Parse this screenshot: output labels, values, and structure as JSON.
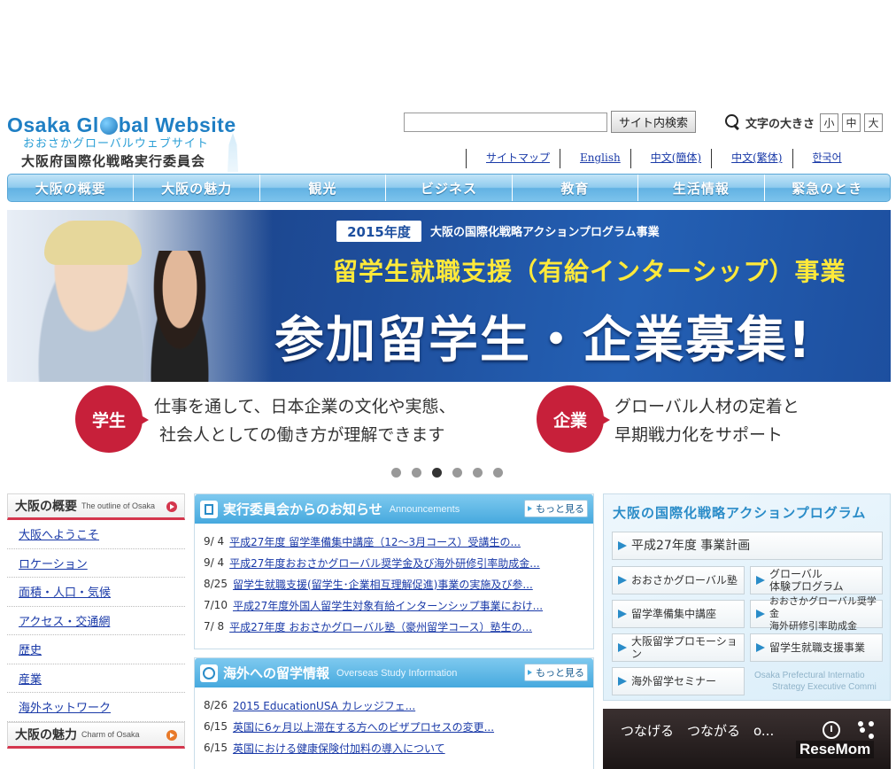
{
  "logo": {
    "en_pre": "Osaka Gl",
    "en_post": "bal Website",
    "jp_sub": "おおさかグローバルウェブサイト",
    "jp_org": "大阪府国際化戦略実行委員会"
  },
  "search": {
    "value": "",
    "button_label": "サイト内検索"
  },
  "font_size": {
    "label": "文字の大きさ",
    "small": "小",
    "medium": "中",
    "large": "大"
  },
  "lang_links": [
    "サイトマップ",
    "English",
    "中文(簡体)",
    "中文(繁体)",
    "한국어"
  ],
  "global_nav": [
    "大阪の概要",
    "大阪の魅力",
    "観光",
    "ビジネス",
    "教育",
    "生活情報",
    "緊急のとき"
  ],
  "hero": {
    "year": "2015年度",
    "subtitle": "大阪の国際化戦略アクションプログラム事業",
    "title1": "留学生就職支援（有給インターシップ）事業",
    "title2": "参加留学生・企業募集!",
    "badge_student": "学生",
    "student_line1": "仕事を通して、日本企業の文化や実態、",
    "student_line2": "社会人としての働き方が理解できます",
    "badge_company": "企業",
    "company_line1": "グローバル人材の定着と",
    "company_line2": "早期戦力化をサポート",
    "slide_count": 6,
    "active_slide": 3
  },
  "sidebar": {
    "section1": {
      "title": "大阪の概要",
      "title_en": "The outline of Osaka",
      "items": [
        "大阪へようこそ",
        "ロケーション",
        "面積・人口・気候",
        "アクセス・交通網",
        "歴史",
        "産業",
        "海外ネットワーク"
      ]
    },
    "section2": {
      "title": "大阪の魅力",
      "title_en": "Charm of Osaka"
    }
  },
  "announcements": {
    "title": "実行委員会からのお知らせ",
    "title_en": "Announcements",
    "more": "もっと見る",
    "items": [
      {
        "date": "9/ 4",
        "text": "平成27年度 留学準備集中講座（12～3月コース）受講生の..."
      },
      {
        "date": "9/ 4",
        "text": "平成27年度おおさかグローバル奨学金及び海外研修引率助成金..."
      },
      {
        "date": "8/25",
        "text": "留学生就職支援(留学生･企業相互理解促進)事業の実施及び参..."
      },
      {
        "date": "7/10",
        "text": "平成27年度外国人留学生対象有給インターンシップ事業におけ..."
      },
      {
        "date": "7/ 8",
        "text": "平成27年度 おおさかグローバル塾（豪州留学コース）塾生の..."
      }
    ]
  },
  "overseas": {
    "title": "海外への留学情報",
    "title_en": "Overseas Study Information",
    "more": "もっと見る",
    "items": [
      {
        "date": "8/26",
        "text": "2015 EducationUSA カレッジフェ..."
      },
      {
        "date": "6/15",
        "text": "英国に6ヶ月以上滞在する方へのビザプロセスの変更..."
      },
      {
        "date": "6/15",
        "text": "英国における健康保険付加料の導入について"
      }
    ]
  },
  "action_program": {
    "title": "大阪の国際化戦略アクションプログラム",
    "plan": "平成27年度 事業計画",
    "btn1": "おおさかグローバル塾",
    "btn2_l1": "グローバル",
    "btn2_l2": "体験プログラム",
    "btn3": "留学準備集中講座",
    "btn4_l1": "おおさかグローバル奨学金",
    "btn4_l2": "海外研修引率助成金",
    "btn5": "大阪留学プロモーション",
    "btn6": "留学生就職支援事業",
    "btn7": "海外留学セミナー",
    "watermark_l1": "Osaka Prefectural Internatio",
    "watermark_l2": "Strategy Executive Commi"
  },
  "video": {
    "title": "つなげる　つながる　o...",
    "brand": "ReseMom"
  },
  "colors": {
    "nav_blue": "#62b2e3",
    "accent_red": "#c7203a",
    "link": "#1a3aa8"
  }
}
